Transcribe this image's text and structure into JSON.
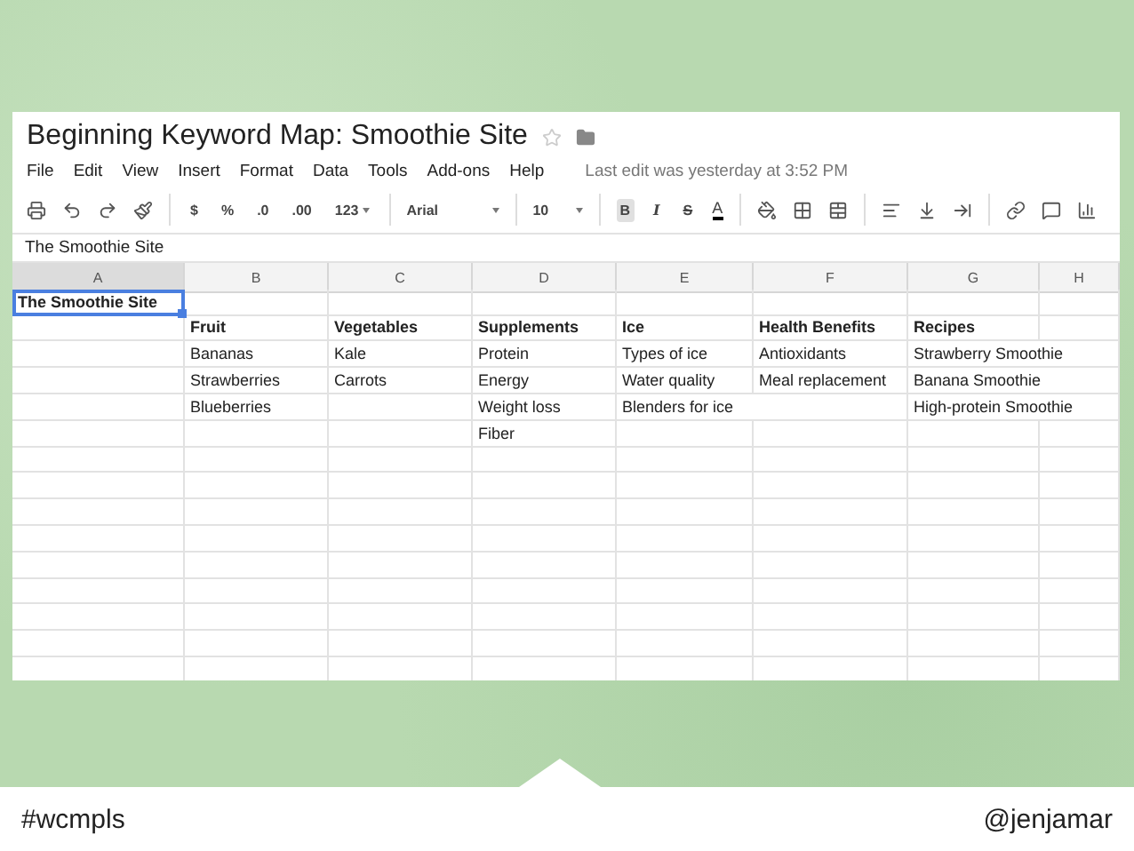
{
  "sheet": {
    "title": "Beginning Keyword Map: Smoothie Site",
    "starred": false,
    "menu": [
      "File",
      "Edit",
      "View",
      "Insert",
      "Format",
      "Data",
      "Tools",
      "Add-ons",
      "Help"
    ],
    "last_edit": "Last edit was yesterday at 3:52 PM",
    "number_formats": [
      "$",
      "%",
      ".0",
      ".00",
      "123"
    ],
    "font": "Arial",
    "font_size": "10",
    "text_styles": [
      {
        "label": "B",
        "selected": true
      },
      {
        "label": "I",
        "selected": false
      },
      {
        "label": "S",
        "selected": false
      }
    ],
    "text_color": "A",
    "formula": "The Smoothie Site",
    "columns": [
      "A",
      "B",
      "C",
      "D",
      "E",
      "F",
      "G",
      "H"
    ],
    "rows": [
      {
        "bold": true,
        "cells": [
          {
            "text": "The Smoothie Site",
            "selected": true
          },
          null,
          null,
          null,
          null,
          null,
          null,
          null
        ]
      },
      {
        "bold": true,
        "cells": [
          null,
          {
            "text": "Fruit",
            "selected": false
          },
          {
            "text": "Vegetables",
            "selected": false
          },
          {
            "text": "Supplements",
            "selected": false
          },
          {
            "text": "Ice",
            "selected": false
          },
          {
            "text": "Health Benefits",
            "selected": false
          },
          {
            "text": "Recipes",
            "selected": false
          },
          null
        ]
      },
      {
        "bold": false,
        "cells": [
          null,
          {
            "text": "Bananas",
            "selected": false
          },
          {
            "text": "Kale",
            "selected": false
          },
          {
            "text": "Protein",
            "selected": false
          },
          {
            "text": "Types of ice",
            "selected": false
          },
          {
            "text": "Antioxidants",
            "selected": false
          },
          {
            "text": "Strawberry Smoothie",
            "selected": false
          },
          null
        ]
      },
      {
        "bold": false,
        "cells": [
          null,
          {
            "text": "Strawberries",
            "selected": false
          },
          {
            "text": "Carrots",
            "selected": false
          },
          {
            "text": "Energy",
            "selected": false
          },
          {
            "text": "Water quality",
            "selected": false
          },
          {
            "text": "Meal replacement",
            "selected": false
          },
          {
            "text": "Banana Smoothie",
            "selected": false
          },
          null
        ]
      },
      {
        "bold": false,
        "cells": [
          null,
          {
            "text": "Blueberries",
            "selected": false
          },
          null,
          {
            "text": "Weight loss",
            "selected": false
          },
          {
            "text": "Blenders for ice",
            "selected": false
          },
          null,
          {
            "text": "High-protein Smoothie",
            "selected": false
          },
          null
        ]
      },
      {
        "bold": false,
        "cells": [
          null,
          null,
          null,
          {
            "text": "Fiber",
            "selected": false
          },
          null,
          null,
          null,
          null
        ]
      }
    ]
  },
  "footer": {
    "hashtag": "#wcmpls",
    "handle": "@jenjamar"
  }
}
